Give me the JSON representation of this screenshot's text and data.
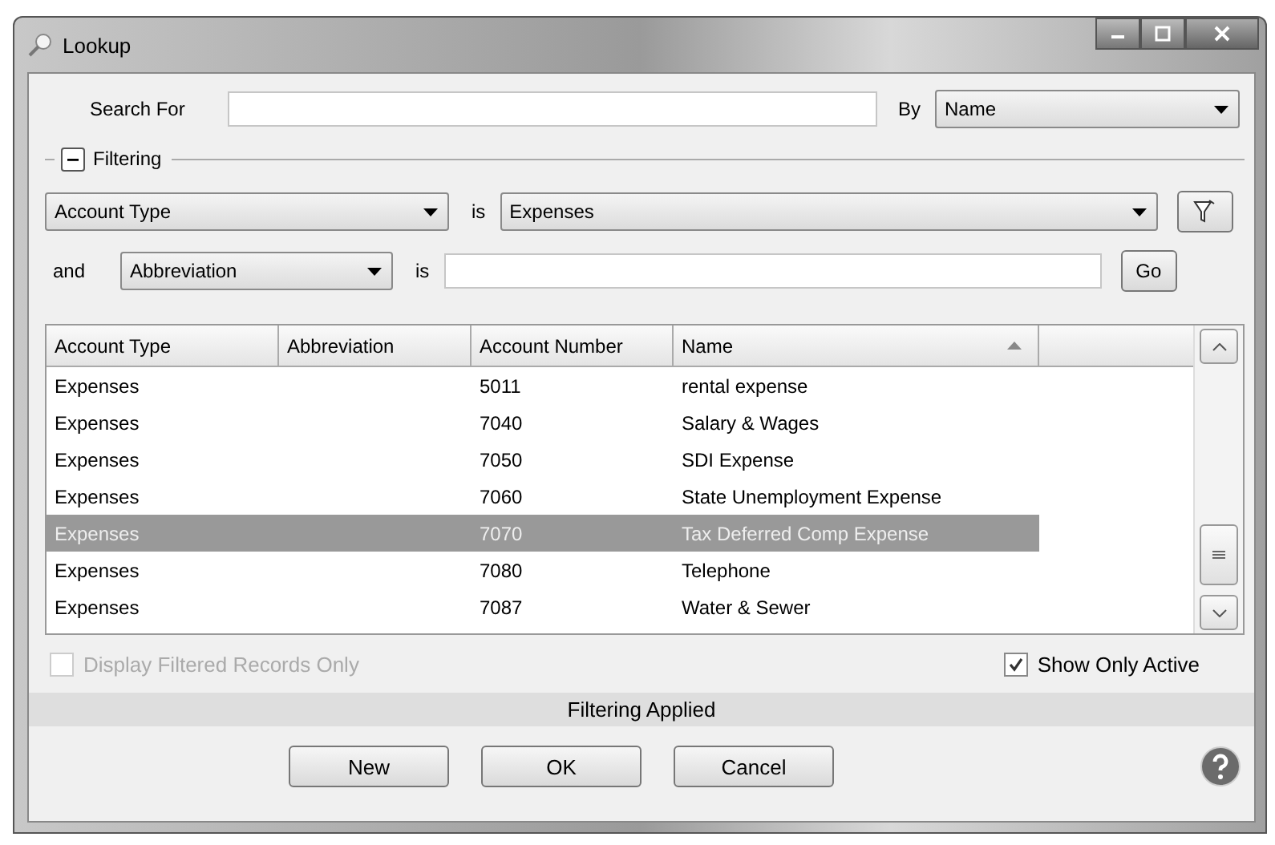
{
  "window": {
    "title": "Lookup"
  },
  "search": {
    "label": "Search For",
    "by_label": "By",
    "by_value": "Name"
  },
  "filtering": {
    "label": "Filtering",
    "expanded": true,
    "rows": [
      {
        "field": "Account Type",
        "operator": "is",
        "value": "Expenses",
        "kind": "select",
        "button": {
          "kind": "icon"
        }
      },
      {
        "conjunction": "and",
        "field": "Abbreviation",
        "operator": "is",
        "kind": "text",
        "button": {
          "kind": "text",
          "label": "Go"
        }
      }
    ]
  },
  "table": {
    "columns": [
      {
        "label": "Account Type",
        "sorted": false
      },
      {
        "label": "Abbreviation",
        "sorted": false
      },
      {
        "label": "Account Number",
        "sorted": false
      },
      {
        "label": "Name",
        "sorted": true
      }
    ],
    "rows": [
      {
        "cells": [
          "Expenses",
          "",
          "5011",
          "rental expense"
        ],
        "selected": false
      },
      {
        "cells": [
          "Expenses",
          "",
          "7040",
          "Salary & Wages"
        ],
        "selected": false
      },
      {
        "cells": [
          "Expenses",
          "",
          "7050",
          "SDI Expense"
        ],
        "selected": false
      },
      {
        "cells": [
          "Expenses",
          "",
          "7060",
          "State Unemployment Expense"
        ],
        "selected": false
      },
      {
        "cells": [
          "Expenses",
          "",
          "7070",
          "Tax Deferred Comp Expense"
        ],
        "selected": true
      },
      {
        "cells": [
          "Expenses",
          "",
          "7080",
          "Telephone"
        ],
        "selected": false
      },
      {
        "cells": [
          "Expenses",
          "",
          "7087",
          "Water & Sewer"
        ],
        "selected": false
      }
    ]
  },
  "options": [
    {
      "label": "Display Filtered Records Only",
      "checked": false,
      "disabled": true
    },
    {
      "label": "Show Only Active",
      "checked": true,
      "disabled": false
    }
  ],
  "status_bar": "Filtering Applied",
  "buttons": [
    "New",
    "OK",
    "Cancel"
  ]
}
